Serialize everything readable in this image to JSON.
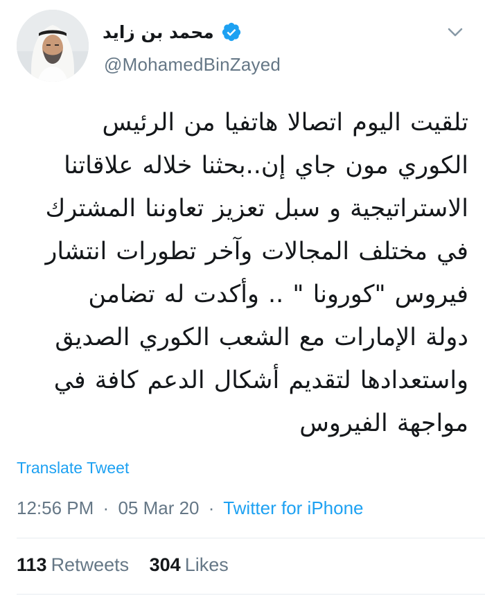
{
  "author": {
    "display_name": "محمد بن زايد",
    "handle": "@MohamedBinZayed",
    "verified": true
  },
  "tweet": {
    "lines": [
      "تلقيت اليوم اتصالا هاتفيا من الرئيس",
      "الكوري مون جاي إن..بحثنا خلاله علاقاتنا",
      "الاستراتيجية و سبل تعزيز  تعاوننا المشترك",
      "في مختلف المجالات وآخر تطورات انتشار",
      "فيروس \"كورونا \" .. وأكدت له تضامن",
      "دولة الإمارات مع الشعب الكوري الصديق",
      "واستعدادها لتقديم أشكال الدعم كافة في",
      "مواجهة الفيروس"
    ],
    "translate_label": "Translate Tweet",
    "time": "12:56 PM",
    "date": "05 Mar 20",
    "separator": "·",
    "source": "Twitter for iPhone"
  },
  "stats": {
    "retweets_count": "113",
    "retweets_label": "Retweets",
    "likes_count": "304",
    "likes_label": "Likes"
  },
  "icons": {
    "verified": "verified-badge-icon",
    "caret": "chevron-down-icon"
  },
  "colors": {
    "link": "#1da1f2",
    "secondary_text": "#657786",
    "primary_text": "#14171a",
    "divider": "#e6ecf0"
  }
}
